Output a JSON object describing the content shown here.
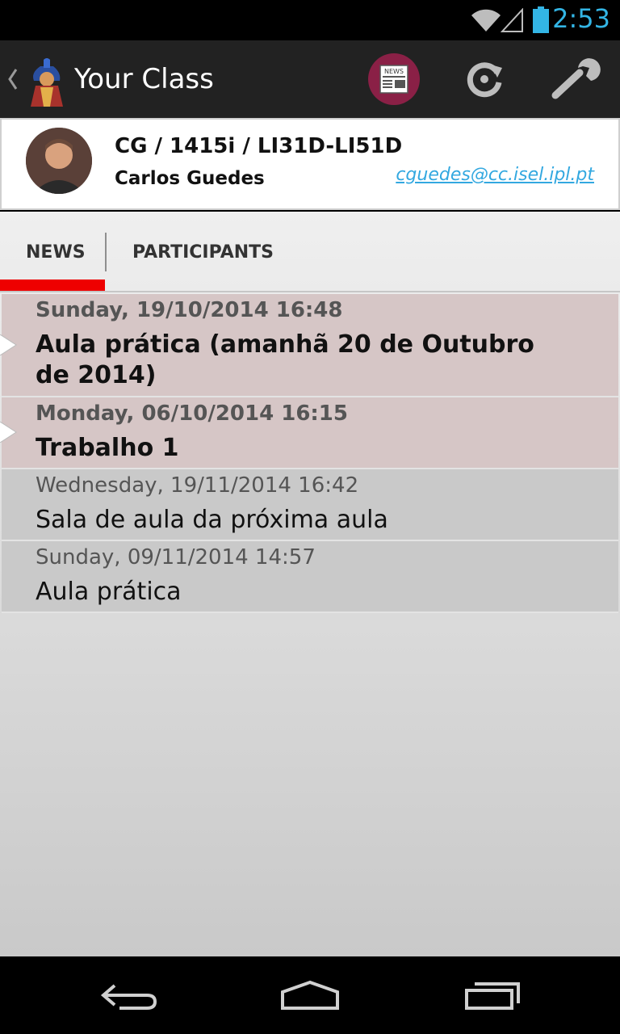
{
  "status_bar": {
    "time": "2:53"
  },
  "action_bar": {
    "title": "Your Class"
  },
  "class_header": {
    "class_code": "CG / 1415i / LI31D-LI51D",
    "teacher_name": "Carlos Guedes",
    "teacher_email": "cguedes@cc.isel.ipl.pt"
  },
  "tabs": [
    {
      "label": "NEWS",
      "selected": true
    },
    {
      "label": "PARTICIPANTS",
      "selected": false
    }
  ],
  "news": [
    {
      "date": "Sunday, 19/10/2014 16:48",
      "title": "Aula prática (amanhã 20 de Outubro de 2014)",
      "unread": true
    },
    {
      "date": "Monday, 06/10/2014 16:15",
      "title": "Trabalho 1",
      "unread": true
    },
    {
      "date": "Wednesday, 19/11/2014 16:42",
      "title": "Sala de aula da próxima aula",
      "unread": false
    },
    {
      "date": "Sunday, 09/11/2014 14:57",
      "title": "Aula prática",
      "unread": false
    }
  ],
  "colors": {
    "accent": "#33b5e5",
    "tab_indicator": "#ee0000",
    "news_button": "#8a2046",
    "unread_row": "#d6c6c6",
    "read_row": "#c9c9c9"
  }
}
